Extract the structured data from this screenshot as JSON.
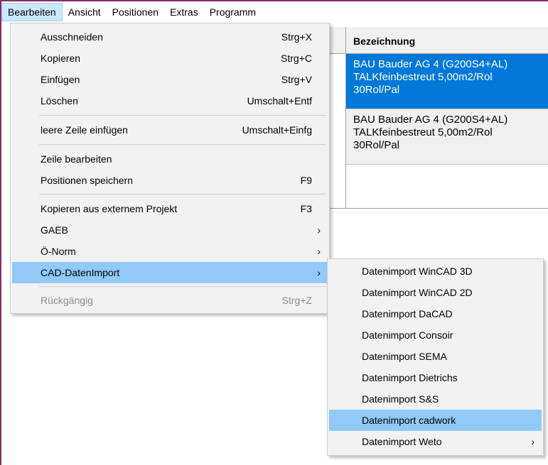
{
  "menubar": {
    "items": [
      {
        "label": "Bearbeiten",
        "active": true
      },
      {
        "label": "Ansicht"
      },
      {
        "label": "Positionen"
      },
      {
        "label": "Extras"
      },
      {
        "label": "Programm"
      }
    ]
  },
  "grid": {
    "header": "Bezeichnung",
    "rows": [
      {
        "line1": "BAU Bauder AG 4 (G200S4+AL)",
        "line2": "TALKfeinbestreut 5,00m2/Rol",
        "line3": "30Rol/Pal",
        "selected": true
      },
      {
        "line1": "BAU Bauder AG 4 (G200S4+AL)",
        "line2": "TALKfeinbestreut 5,00m2/Rol",
        "line3": "30Rol/Pal",
        "selected": false
      }
    ]
  },
  "edit_menu": {
    "items": [
      {
        "label": "Ausschneiden",
        "shortcut": "Strg+X"
      },
      {
        "label": "Kopieren",
        "shortcut": "Strg+C"
      },
      {
        "label": "Einfügen",
        "shortcut": "Strg+V"
      },
      {
        "label": "Löschen",
        "shortcut": "Umschalt+Entf"
      },
      {
        "label": "leere Zeile einfügen",
        "shortcut": "Umschalt+Einfg"
      },
      {
        "label": "Zeile bearbeiten",
        "shortcut": ""
      },
      {
        "label": "Positionen speichern",
        "shortcut": "F9"
      },
      {
        "label": "Kopieren aus externem Projekt",
        "shortcut": "F3"
      },
      {
        "label": "GAEB",
        "arrow": "›"
      },
      {
        "label": "Ö-Norm",
        "arrow": "›"
      },
      {
        "label": "CAD-DatenImport",
        "arrow": "›",
        "highlighted": true
      },
      {
        "label": "Rückgängig",
        "shortcut": "Strg+Z",
        "disabled": true
      }
    ]
  },
  "cad_submenu": {
    "items": [
      {
        "label": "Datenimport WinCAD 3D"
      },
      {
        "label": "Datenimport WinCAD 2D"
      },
      {
        "label": "Datenimport DaCAD"
      },
      {
        "label": "Datenimport Consoir"
      },
      {
        "label": "Datenimport SEMA"
      },
      {
        "label": "Datenimport Dietrichs"
      },
      {
        "label": "Datenimport S&S"
      },
      {
        "label": "Datenimport cadwork",
        "highlighted": true
      },
      {
        "label": "Datenimport Weto",
        "arrow": "›"
      }
    ]
  },
  "colors": {
    "selection": "#0078d7",
    "menu_highlight": "#91c9f7",
    "menubar_active": "#cce8ff",
    "window_frame": "#8a2a6a"
  }
}
